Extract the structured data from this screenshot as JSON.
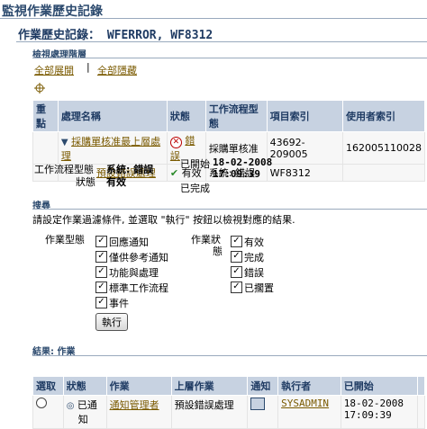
{
  "page_title": "監視作業歷史記錄",
  "sub_title": "作業歷史記錄： WFERROR, WF8312",
  "hierarchy": {
    "section_title": "檢視處理階層",
    "expand_all": "全部展開",
    "collapse_all": "全部隱藏",
    "columns": [
      "重點",
      "處理名稱",
      "狀態",
      "工作流程型態",
      "項目索引",
      "使用者索引"
    ],
    "rows": [
      {
        "name": "採購單核准最上層處理",
        "status": "錯誤",
        "type": "採購單核准",
        "item_key": "43692-209005",
        "user_key": "162005110028"
      },
      {
        "name": "預設錯誤處理",
        "status": "有效",
        "type": "系統: 錯誤",
        "item_key": "WF8312",
        "user_key": ""
      }
    ]
  },
  "details": {
    "type_label": "工作流程型態",
    "type_value": "系統: 錯誤",
    "status_label": "狀態",
    "status_value": "有效",
    "started_label": "已開始",
    "started_value_line1": "18-02-2008",
    "started_value_line2": "17:09:39",
    "completed_label": "已完成"
  },
  "search": {
    "section_title": "搜尋",
    "instructions": "請設定作業過濾條件, 並選取 \"執行\" 按鈕以檢視對應的結果.",
    "activity_type_label": "作業型態",
    "activity_status_label_1": "作業狀",
    "activity_status_label_2": "態",
    "type_options": [
      "回應通知",
      "僅供參考通知",
      "功能與處理",
      "標準工作流程",
      "事件"
    ],
    "status_options": [
      "有效",
      "完成",
      "錯誤",
      "已擱置"
    ],
    "go_button": "執行"
  },
  "results": {
    "section_title": "結果: 作業",
    "columns": [
      "選取",
      "狀態",
      "作業",
      "上層作業",
      "通知",
      "執行者",
      "已開始",
      ""
    ],
    "rows": [
      {
        "status_line1": "已通",
        "status_line2": "知",
        "activity": "通知管理者",
        "parent_activity": "預設錯誤處理",
        "performer": "SYSADMIN",
        "started_line1": "18-02-2008",
        "started_line2": "17:09:39"
      }
    ]
  }
}
